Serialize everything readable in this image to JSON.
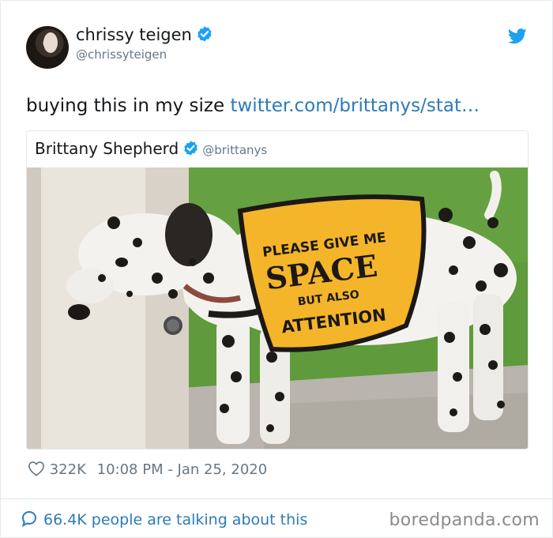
{
  "author": {
    "display_name": "chrissy teigen",
    "handle": "@chrissyteigen",
    "verified": true
  },
  "tweet": {
    "text": "buying this in my size ",
    "link_text": "twitter.com/brittanys/stat…"
  },
  "quoted_tweet": {
    "display_name": "Brittany Shepherd",
    "handle": "@brittanys",
    "verified": true,
    "image": {
      "vest_line_1": "PLEASE GIVE ME",
      "vest_line_2": "SPACE",
      "vest_line_3": "BUT ALSO",
      "vest_line_4": "ATTENTION"
    }
  },
  "stats": {
    "likes": "322K",
    "timestamp": "10:08 PM - Jan 25, 2020"
  },
  "footer": {
    "talking_text": "66.4K people are talking about this",
    "watermark": "boredpanda.com"
  },
  "colors": {
    "twitter_blue": "#1da1f2",
    "link_blue": "#2b7bb9",
    "muted_gray": "#657786",
    "vest_yellow": "#f5b52a"
  },
  "icons": {
    "verified": "verified-badge-icon",
    "brand": "twitter-bird-icon",
    "like": "heart-outline-icon",
    "reply": "speech-bubble-icon"
  }
}
